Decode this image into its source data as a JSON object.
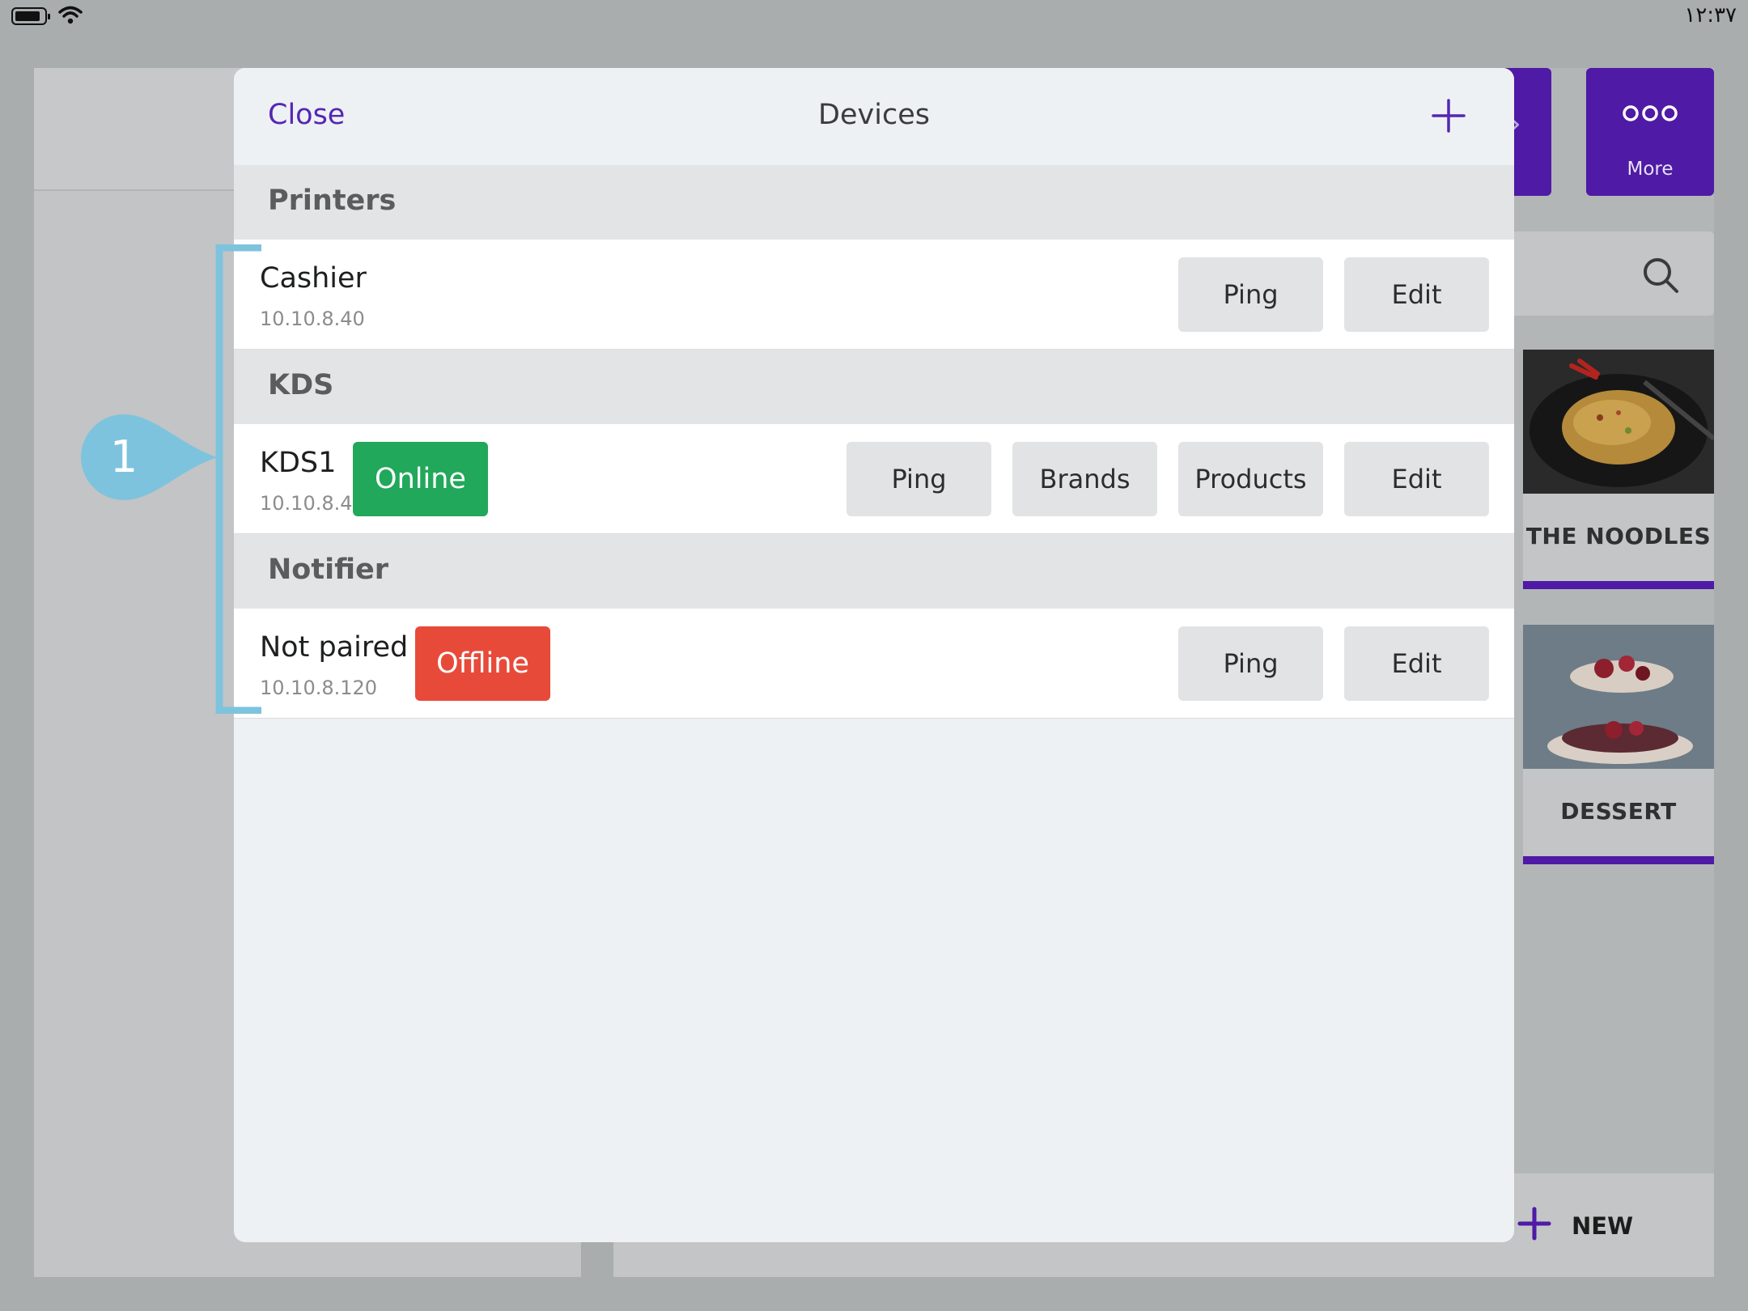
{
  "status_bar": {
    "time": "۱۲:۳۷"
  },
  "background": {
    "more_label": "More",
    "categories": [
      {
        "label": "THE NOODLES"
      },
      {
        "label": "DESSERT"
      }
    ],
    "new_label": "NEW"
  },
  "modal": {
    "close_label": "Close",
    "title": "Devices",
    "sections": [
      {
        "title": "Printers",
        "devices": [
          {
            "name": "Cashier",
            "ip": "10.10.8.40",
            "actions": [
              "Ping",
              "Edit"
            ]
          }
        ]
      },
      {
        "title": "KDS",
        "devices": [
          {
            "name": "KDS1",
            "ip": "10.10.8.41",
            "status": "Online",
            "actions": [
              "Ping",
              "Brands",
              "Products",
              "Edit"
            ]
          }
        ]
      },
      {
        "title": "Notifier",
        "devices": [
          {
            "name": "Not paired",
            "ip": "10.10.8.120",
            "status": "Offline",
            "actions": [
              "Ping",
              "Edit"
            ]
          }
        ]
      }
    ]
  },
  "callout": {
    "number": "1",
    "color": "#7ec3dd"
  },
  "colors": {
    "accent": "#5427b3",
    "brand_purple": "#4f1aa5",
    "online": "#21a85a",
    "offline": "#e84a3a"
  }
}
